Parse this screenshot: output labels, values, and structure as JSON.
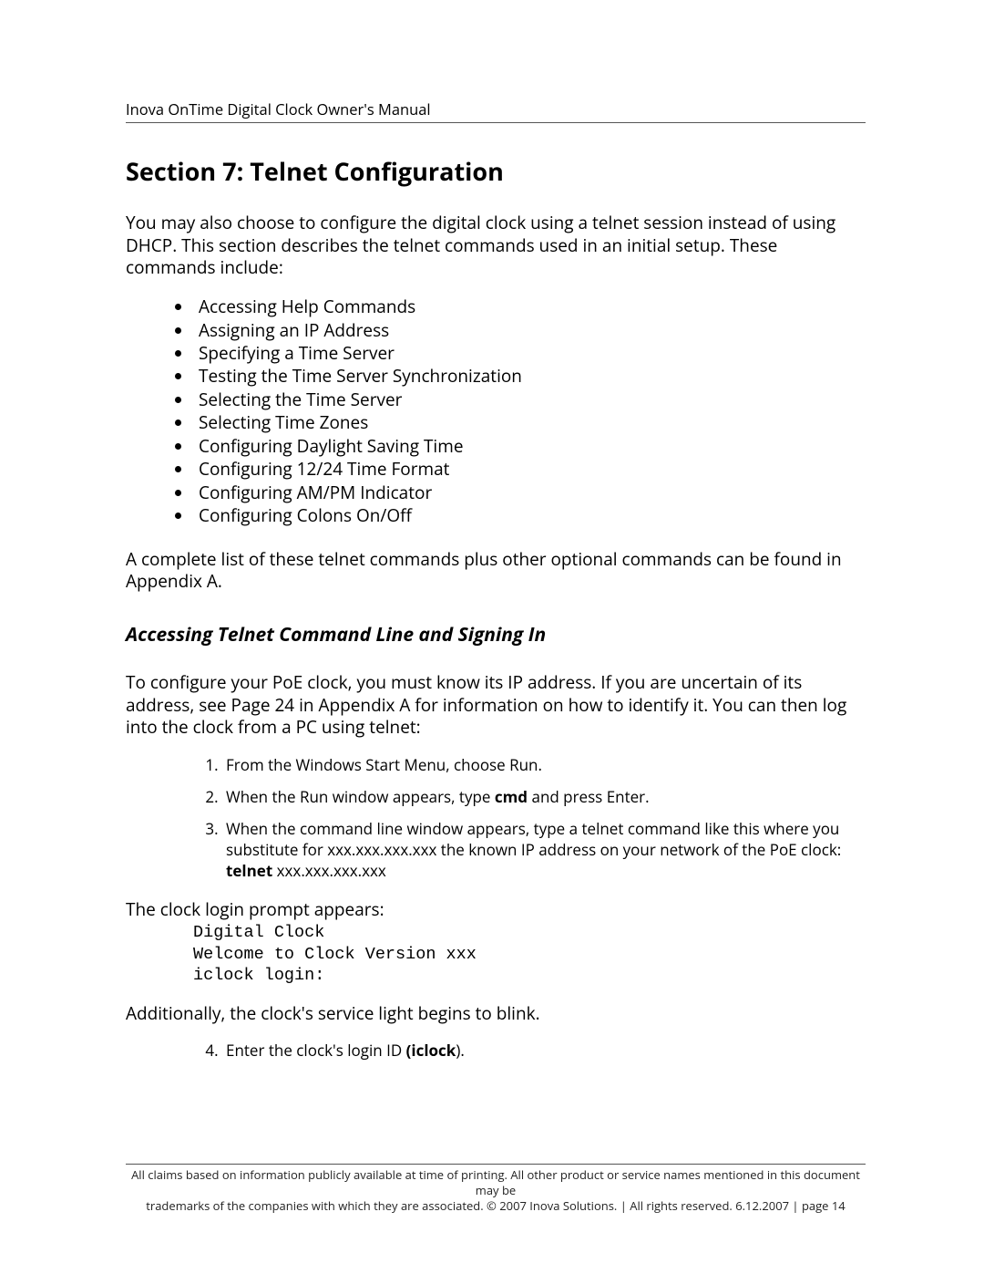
{
  "header": {
    "running_head": "Inova OnTime Digital Clock Owner's Manual"
  },
  "section": {
    "title": "Section 7:  Telnet Configuration",
    "intro": "You may also choose to configure the digital clock using a telnet session instead of using DHCP.  This section describes the telnet commands used in an initial setup.   These commands include:",
    "bullets": [
      "Accessing Help Commands",
      "Assigning an IP Address",
      "Specifying a Time Server",
      "Testing the Time Server Synchronization",
      "Selecting the Time Server",
      "Selecting Time Zones",
      "Configuring Daylight Saving Time",
      "Configuring 12/24 Time Format",
      "Configuring AM/PM Indicator",
      "Configuring Colons On/Off"
    ],
    "after_bullets": "A complete list of these telnet commands plus other optional commands can be found in Appendix A."
  },
  "sub": {
    "heading": "Accessing Telnet Command Line and Signing In",
    "intro": "To configure your PoE clock, you must know its IP address.   If you are uncertain of its address, see Page 24 in Appendix A for information on how to identify it. You can then log into the clock from a PC using telnet:",
    "step1": "From the Windows Start Menu, choose Run.",
    "step2_a": "When the Run window appears, type ",
    "step2_b": "cmd",
    "step2_c": " and press Enter.",
    "step3_a": "When the command line window appears, type a telnet command like this where you substitute for xxx.xxx.xxx.xxx the known IP address on your network of the PoE clock: ",
    "step3_b": "telnet ",
    "step3_c": "xxx.xxx.xxx.xxx",
    "prompt_intro": "The clock login prompt appears:",
    "code": "Digital Clock\nWelcome to Clock Version xxx\niclock login:",
    "after_code": "Additionally, the clock's service light begins to blink.",
    "step4_a": "Enter the clock's login ID ",
    "step4_b": "(iclock",
    "step4_c": ")."
  },
  "footer": {
    "line1": "All claims based on information publicly available at time of printing. All other product or service names mentioned in this document may be",
    "line2": "trademarks of the companies with which they are associated. © 2007 Inova Solutions.  |  All rights reserved. 6.12.2007  |  page 14"
  }
}
